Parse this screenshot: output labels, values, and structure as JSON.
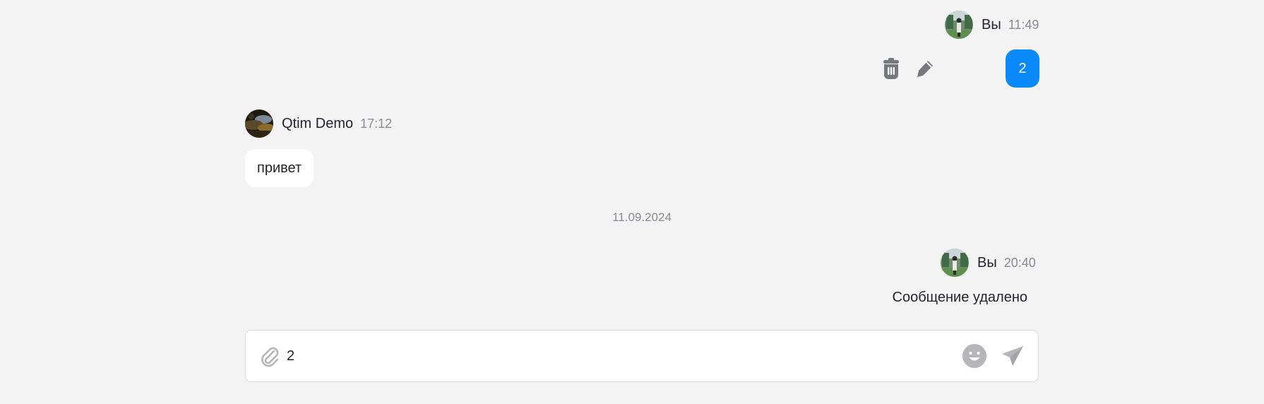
{
  "messages": [
    {
      "author": "Вы",
      "time": "11:49",
      "text": "2",
      "avatar_icon": "user-avatar-photo"
    },
    {
      "author": "Qtim Demo",
      "time": "17:12",
      "text": "привет",
      "avatar_icon": "contact-avatar-photo"
    },
    {
      "author": "Вы",
      "time": "20:40",
      "text": "Сообщение удалено",
      "avatar_icon": "user-avatar-photo"
    }
  ],
  "message_actions": {
    "delete_icon": "trash-icon",
    "edit_icon": "pencil-icon"
  },
  "date_separator": "11.09.2024",
  "composer": {
    "value": "2",
    "attach_icon": "paperclip-icon",
    "emoji_icon": "smiley-icon",
    "send_icon": "paper-plane-icon"
  },
  "colors": {
    "background": "#f3f3f3",
    "outgoing_bubble": "#0a8af8",
    "incoming_bubble": "#ffffff",
    "muted_text": "#8a8a92",
    "icon_gray": "#b5b5ba"
  }
}
